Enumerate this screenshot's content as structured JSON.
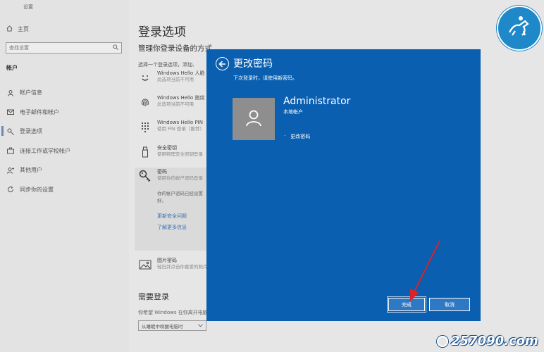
{
  "app": {
    "title": "设置"
  },
  "sidebar": {
    "home_label": "主页",
    "search_placeholder": "查找设置",
    "section_label": "帐户",
    "items": [
      {
        "label": "帐户信息",
        "icon": "person-card-icon"
      },
      {
        "label": "电子邮件和帐户",
        "icon": "mail-icon"
      },
      {
        "label": "登录选项",
        "icon": "key-icon"
      },
      {
        "label": "连接工作或学校帐户",
        "icon": "briefcase-icon"
      },
      {
        "label": "其他用户",
        "icon": "person-add-icon"
      },
      {
        "label": "同步你的设置",
        "icon": "sync-icon"
      }
    ]
  },
  "main": {
    "title": "登录选项",
    "subtitle": "管理你登录设备的方式",
    "select_hint": "选择一个登录选项，添加、",
    "options": [
      {
        "title": "Windows Hello 人脸",
        "sub": "此选项当前不可用",
        "icon": "face-icon"
      },
      {
        "title": "Windows Hello 指纹",
        "sub": "此选项当前不可用",
        "icon": "fingerprint-icon"
      },
      {
        "title": "Windows Hello PIN",
        "sub": "使用 PIN 登录（推荐）",
        "icon": "pin-keypad-icon"
      },
      {
        "title": "安全密钥",
        "sub": "使用物理安全密钥登录",
        "icon": "usb-key-icon"
      },
      {
        "title": "密码",
        "sub": "使用你的帐户密码登录",
        "icon": "password-key-icon"
      }
    ],
    "password_desc": "你的帐户密码已经设置好。",
    "links": [
      "更新安全问题",
      "了解更多信息"
    ],
    "picture_password": {
      "title": "图片密码",
      "sub": "轻扫并点击你喜爱的照片"
    },
    "need_signin": {
      "title": "需要登录",
      "desc": "你希望 Windows 在你离开电脑多久后要求你重新登录？",
      "value": "从睡眠中唤醒电脑时"
    }
  },
  "dialog": {
    "title": "更改密码",
    "subtitle": "下次登录时，请使用新密码。",
    "user_name": "Administrator",
    "user_type": "本地帐户",
    "change_label": "更改密码",
    "finish_label": "完成",
    "cancel_label": "取消"
  },
  "watermark": {
    "text": "257090.com"
  },
  "colors": {
    "dialog_bg": "#0a5fb0",
    "link": "#3a6fb0",
    "arrow": "#d8232a",
    "logo": "#1e88c8"
  }
}
